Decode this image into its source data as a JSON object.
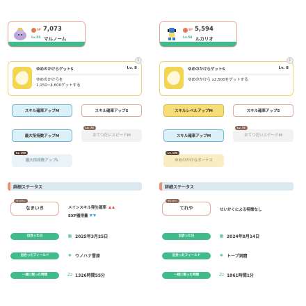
{
  "left": {
    "pokemon": {
      "cp_label": "SP",
      "cp": "7,073",
      "level": "Lv.55",
      "name": "マルノーム"
    },
    "main_skill": {
      "title": "ゆめのかけらゲットS",
      "level": "Lv. 8",
      "desc_line1": "ゆめのかけらを",
      "desc_line2": "1,150~4,600ゲットする"
    },
    "subskills": {
      "s1": "スキル確率アップM",
      "s2": "スキル確率アップS",
      "s3": "最大所持数アップM",
      "s4": "おてつだいスピードM",
      "s4_badge": "Lv. 75",
      "s5": "最大所持数アップL",
      "s5_badge": "Lv. 100"
    },
    "details": {
      "header": "詳細ステータス",
      "nature_tag": "せいかく",
      "nature": "なまいき",
      "nature_up": "メインスキル発生確率",
      "nature_down": "EXP獲得量",
      "met_label": "出会った日",
      "met_value": "2025年3月25日",
      "field_label": "出会ったフィールド",
      "field_value": "ウノハナ雪原",
      "sleep_label": "一緒に眠った時間",
      "sleep_icon": "Zz",
      "sleep_value": "1326時間55分"
    }
  },
  "right": {
    "pokemon": {
      "cp_label": "SP",
      "cp": "5,594",
      "level": "Lv.58",
      "name": "ルカリオ"
    },
    "main_skill": {
      "title": "ゆめのかけらゲットS",
      "level": "Lv. 8",
      "desc_line1": "ゆめのかけら x2,500をゲットする",
      "desc_line2": ""
    },
    "subskills": {
      "s1": "スキルレベルアップM",
      "s2": "スキル確率アップS",
      "s3": "スキル確率アップM",
      "s4": "おてつだいスピードM",
      "s4_badge": "Lv. 75",
      "s5": "ゆめのかけらボーナス",
      "s5_badge": "Lv. 100"
    },
    "details": {
      "header": "詳細ステータス",
      "nature_tag": "せいかく",
      "nature": "てれや",
      "nature_text": "せいかくによる特徴なし",
      "met_label": "出会った日",
      "met_value": "2024年8月14日",
      "field_label": "出会ったフィールド",
      "field_value": "トープ洞窟",
      "sleep_label": "一緒に眠った時間",
      "sleep_icon": "Zz",
      "sleep_value": "1861時間1分"
    }
  },
  "colors": {
    "green": "#3fbb8c",
    "coral": "#e8a89e",
    "gold": "#f2d652",
    "blue": "#6fb7d7"
  }
}
